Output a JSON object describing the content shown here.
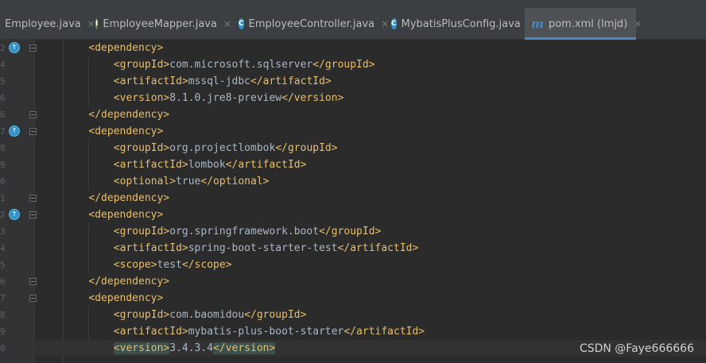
{
  "tabs": [
    {
      "label": "Employee.java",
      "icon": "",
      "active": false
    },
    {
      "label": "EmployeeMapper.java",
      "icon": "I",
      "icon_color": "#6a8759",
      "active": false
    },
    {
      "label": "EmployeeController.java",
      "icon": "C",
      "icon_color": "#3592c4",
      "active": false
    },
    {
      "label": "MybatisPlusConfig.java",
      "icon": "C",
      "icon_color": "#3592c4",
      "active": false
    },
    {
      "label": "pom.xml (lmjd)",
      "icon": "m",
      "active": true
    }
  ],
  "close_glyph": "×",
  "gutter": {
    "line_digits": [
      "2",
      "4",
      "5",
      "6",
      "6",
      "7",
      "8",
      "9",
      "0",
      "1",
      "2",
      "3",
      "4",
      "5",
      "6",
      "7",
      "8",
      "9",
      "0"
    ],
    "run_icon_glyph": "↑"
  },
  "code_lines": [
    {
      "indent": 4,
      "parts": [
        [
          "tag",
          "<dependency>"
        ]
      ]
    },
    {
      "indent": 8,
      "parts": [
        [
          "tag",
          "<groupId>"
        ],
        [
          "txt",
          "com.microsoft.sqlserver"
        ],
        [
          "tag",
          "</groupId>"
        ]
      ]
    },
    {
      "indent": 8,
      "parts": [
        [
          "tag",
          "<artifactId>"
        ],
        [
          "txt",
          "mssql-jdbc"
        ],
        [
          "tag",
          "</artifactId>"
        ]
      ]
    },
    {
      "indent": 8,
      "parts": [
        [
          "tag",
          "<version>"
        ],
        [
          "txt",
          "8.1.0.jre8-preview"
        ],
        [
          "tag",
          "</version>"
        ]
      ]
    },
    {
      "indent": 4,
      "parts": [
        [
          "tag",
          "</dependency>"
        ]
      ]
    },
    {
      "indent": 4,
      "parts": [
        [
          "tag",
          "<dependency>"
        ]
      ]
    },
    {
      "indent": 8,
      "parts": [
        [
          "tag",
          "<groupId>"
        ],
        [
          "txt",
          "org.projectlombok"
        ],
        [
          "tag",
          "</groupId>"
        ]
      ]
    },
    {
      "indent": 8,
      "parts": [
        [
          "tag",
          "<artifactId>"
        ],
        [
          "txt",
          "lombok"
        ],
        [
          "tag",
          "</artifactId>"
        ]
      ]
    },
    {
      "indent": 8,
      "parts": [
        [
          "tag",
          "<optional>"
        ],
        [
          "txt",
          "true"
        ],
        [
          "tag",
          "</optional>"
        ]
      ]
    },
    {
      "indent": 4,
      "parts": [
        [
          "tag",
          "</dependency>"
        ]
      ]
    },
    {
      "indent": 4,
      "parts": [
        [
          "tag",
          "<dependency>"
        ]
      ]
    },
    {
      "indent": 8,
      "parts": [
        [
          "tag",
          "<groupId>"
        ],
        [
          "txt",
          "org.springframework.boot"
        ],
        [
          "tag",
          "</groupId>"
        ]
      ]
    },
    {
      "indent": 8,
      "parts": [
        [
          "tag",
          "<artifactId>"
        ],
        [
          "txt",
          "spring-boot-starter-test"
        ],
        [
          "tag",
          "</artifactId>"
        ]
      ]
    },
    {
      "indent": 8,
      "parts": [
        [
          "tag",
          "<scope>"
        ],
        [
          "txt",
          "test"
        ],
        [
          "tag",
          "</scope>"
        ]
      ]
    },
    {
      "indent": 4,
      "parts": [
        [
          "tag",
          "</dependency>"
        ]
      ]
    },
    {
      "indent": 4,
      "parts": [
        [
          "tag",
          "<dependency>"
        ]
      ]
    },
    {
      "indent": 8,
      "parts": [
        [
          "tag",
          "<groupId>"
        ],
        [
          "txt",
          "com.baomidou"
        ],
        [
          "tag",
          "</groupId>"
        ]
      ]
    },
    {
      "indent": 8,
      "parts": [
        [
          "tag",
          "<artifactId>"
        ],
        [
          "txt",
          "mybatis-plus-boot-starter"
        ],
        [
          "tag",
          "</artifactId>"
        ]
      ]
    },
    {
      "indent": 8,
      "parts": [
        [
          "tagh",
          "<version>"
        ],
        [
          "txt",
          "3.4.3.4"
        ],
        [
          "tagh",
          "</version>"
        ]
      ],
      "current": true
    }
  ],
  "watermark": "CSDN @Faye666666",
  "colors": {
    "tag": "#e8bf6a",
    "text": "#a9b7c6",
    "background": "#2b2b2b",
    "accent": "#4a88c7"
  }
}
